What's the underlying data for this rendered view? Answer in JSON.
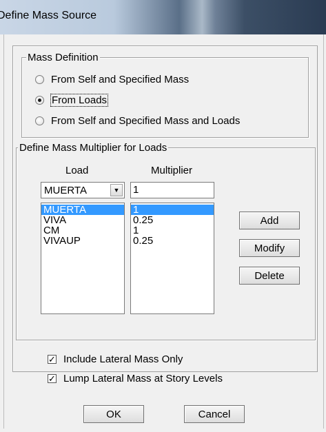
{
  "window": {
    "title": "Define Mass Source"
  },
  "mass_definition": {
    "legend": "Mass Definition",
    "options": [
      {
        "label": "From Self and Specified Mass",
        "selected": false
      },
      {
        "label": "From Loads",
        "selected": true
      },
      {
        "label": "From Self and Specified Mass and Loads",
        "selected": false
      }
    ]
  },
  "multiplier_group": {
    "legend": "Define Mass Multiplier for Loads",
    "load_header": "Load",
    "multiplier_header": "Multiplier",
    "load_combo_value": "MUERTA",
    "multiplier_value": "1",
    "rows": [
      {
        "load": "MUERTA",
        "multiplier": "1",
        "selected": true
      },
      {
        "load": "VIVA",
        "multiplier": "0.25",
        "selected": false
      },
      {
        "load": "CM",
        "multiplier": "1",
        "selected": false
      },
      {
        "load": "VIVAUP",
        "multiplier": "0.25",
        "selected": false
      }
    ],
    "add_label": "Add",
    "modify_label": "Modify",
    "delete_label": "Delete"
  },
  "options": {
    "include_lateral": {
      "label": "Include Lateral Mass Only",
      "checked": true
    },
    "lump_lateral": {
      "label": "Lump Lateral Mass at Story Levels",
      "checked": true
    }
  },
  "buttons": {
    "ok": "OK",
    "cancel": "Cancel"
  },
  "icons": {
    "combo_arrow": "chevron-down-icon",
    "check": "check-icon"
  }
}
